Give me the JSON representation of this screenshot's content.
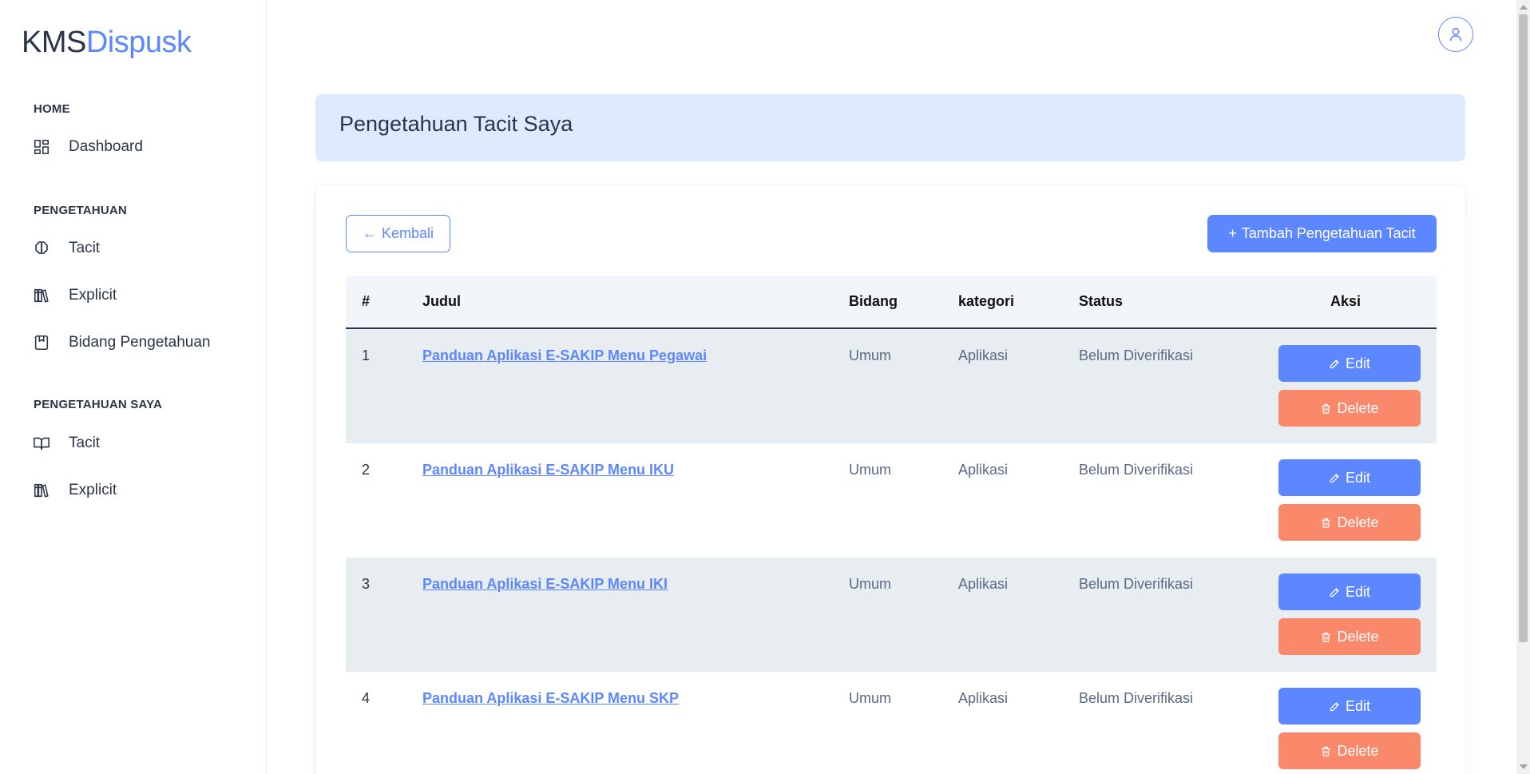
{
  "brand": {
    "part1": "KMS",
    "part2": "Dispusk"
  },
  "sidebar": {
    "sections": [
      {
        "label": "HOME"
      },
      {
        "label": "PENGETAHUAN"
      },
      {
        "label": "PENGETAHUAN SAYA"
      }
    ],
    "items": [
      {
        "label": "Dashboard",
        "icon": "dashboard-icon"
      },
      {
        "label": "Tacit",
        "icon": "brain-icon"
      },
      {
        "label": "Explicit",
        "icon": "books-icon"
      },
      {
        "label": "Bidang Pengetahuan",
        "icon": "bookmark-icon"
      },
      {
        "label": "Tacit",
        "icon": "open-book-icon"
      },
      {
        "label": "Explicit",
        "icon": "books-icon"
      }
    ]
  },
  "header": {
    "title": "Pengetahuan Tacit Saya"
  },
  "actions": {
    "back_label": "Kembali",
    "add_label": "Tambah Pengetahuan Tacit"
  },
  "table": {
    "columns": [
      "#",
      "Judul",
      "Bidang",
      "kategori",
      "Status",
      "Aksi"
    ],
    "rows": [
      {
        "no": "1",
        "judul": "Panduan Aplikasi E-SAKIP Menu Pegawai",
        "bidang": "Umum",
        "kategori": "Aplikasi",
        "status": "Belum Diverifikasi"
      },
      {
        "no": "2",
        "judul": "Panduan Aplikasi E-SAKIP Menu IKU",
        "bidang": "Umum",
        "kategori": "Aplikasi",
        "status": "Belum Diverifikasi"
      },
      {
        "no": "3",
        "judul": "Panduan Aplikasi E-SAKIP Menu IKI",
        "bidang": "Umum",
        "kategori": "Aplikasi",
        "status": "Belum Diverifikasi"
      },
      {
        "no": "4",
        "judul": "Panduan Aplikasi E-SAKIP Menu SKP",
        "bidang": "Umum",
        "kategori": "Aplikasi",
        "status": "Belum Diverifikasi"
      }
    ],
    "edit_label": "Edit",
    "delete_label": "Delete"
  },
  "colors": {
    "primary": "#5d87ff",
    "danger": "#fa896b",
    "header_bg": "#deeafd",
    "text": "#2a3547"
  }
}
